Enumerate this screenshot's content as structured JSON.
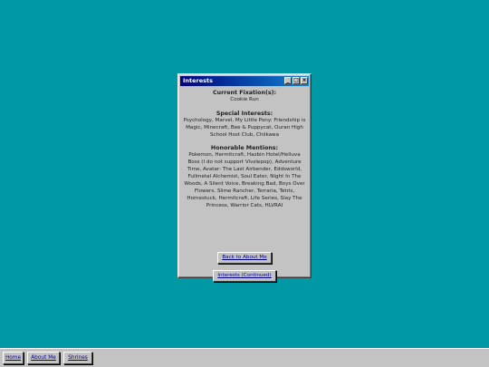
{
  "window": {
    "title": "Interests",
    "controls": {
      "minimize": "_",
      "maximize": "□",
      "close": "×"
    }
  },
  "content": {
    "fixation_heading": "Current Fixation(s):",
    "fixation_text": "Cookie Run",
    "special_heading": "Special Interests:",
    "special_text": "Psychology, Marvel, My Little Pony: Friendship is Magic, Minecraft, Bee & Puppycat, Ouran High School Host Club, Chiikawa",
    "honorable_heading": "Honorable Mentions:",
    "honorable_text": "Pokemon, Hermitcraft, Hazbin Hotel/Helluva Boss (I do not support Vivziepop), Adventure Time, Avatar: The Last Airbender, Eddsworld, Fullmetal Alchemist, Soul Eater, Night In The Woods, A Silent Voice, Breaking Bad, Boys Over Flowers, Slime Rancher, Terraria, Tetris, Homestuck, Hermitcraft, Life Series, Slay The Princess, Warrior Cats, HLVRAI"
  },
  "buttons": {
    "back": "Back to About Me",
    "continued": "Interests (Continued)"
  },
  "taskbar": {
    "home": "Home",
    "about": "About Me",
    "shrines": "Shrines"
  }
}
